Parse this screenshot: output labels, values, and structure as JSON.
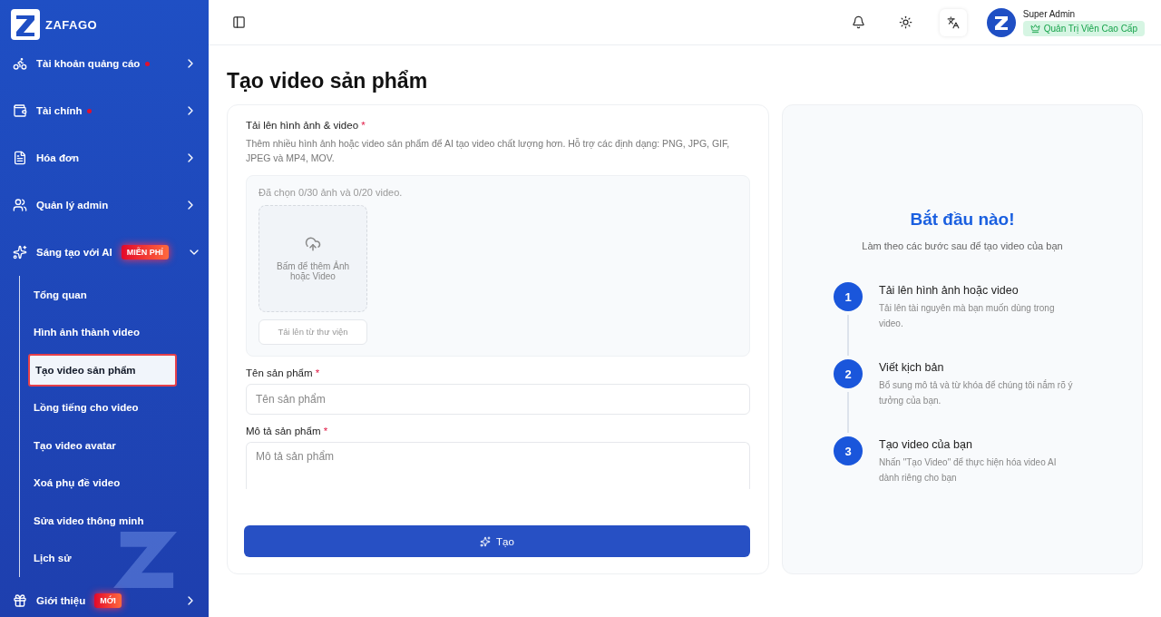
{
  "brand": {
    "name": "ZAFAGO"
  },
  "sidebar": {
    "items": [
      {
        "label": "Tài khoản quảng cáo",
        "dot": true,
        "expanded": false
      },
      {
        "label": "Tài chính",
        "dot": true,
        "expanded": false
      },
      {
        "label": "Hóa đơn",
        "dot": false,
        "expanded": false
      },
      {
        "label": "Quản lý admin",
        "dot": false,
        "expanded": false
      },
      {
        "label": "Sáng tạo với AI",
        "dot": false,
        "badge": "MIỄN PHÍ",
        "expanded": true,
        "children": [
          {
            "label": "Tổng quan",
            "selected": false
          },
          {
            "label": "Hình ảnh thành video",
            "selected": false
          },
          {
            "label": "Tạo video sản phẩm",
            "selected": true
          },
          {
            "label": "Lồng tiếng cho video",
            "selected": false
          },
          {
            "label": "Tạo video avatar",
            "selected": false
          },
          {
            "label": "Xoá phụ đề video",
            "selected": false
          },
          {
            "label": "Sửa video thông minh",
            "selected": false
          },
          {
            "label": "Lịch sử",
            "selected": false
          }
        ]
      },
      {
        "label": "Giới thiệu",
        "dot": false,
        "badge": "MỚI",
        "expanded": false
      }
    ]
  },
  "header": {
    "user": {
      "name": "Super Admin",
      "role": "Quản Trị Viên Cao Cấp"
    }
  },
  "page": {
    "title": "Tạo video sản phẩm"
  },
  "form": {
    "upload": {
      "label": "Tải lên hình ảnh & video",
      "required_mark": "*",
      "description": "Thêm nhiều hình ảnh hoặc video sản phẩm để AI tạo video chất lượng hơn. Hỗ trợ các định dạng: PNG, JPG, GIF, JPEG và MP4, MOV.",
      "count": "Đã chọn 0/30 ảnh và 0/20 video.",
      "dropzone": "Bấm để thêm Ảnh hoặc Video",
      "library_button": "Tải lên từ thư viện"
    },
    "fields": [
      {
        "kind": "input",
        "label": "Tên sản phẩm",
        "required_mark": "*",
        "placeholder": "Tên sản phẩm"
      },
      {
        "kind": "textarea",
        "label": "Mô tả sản phẩm",
        "required_mark": "*",
        "placeholder": "Mô tả sản phẩm"
      }
    ],
    "submit": "Tạo"
  },
  "guide": {
    "title": "Bắt đầu nào!",
    "subtitle": "Làm theo các bước sau để tạo video của bạn",
    "steps": [
      {
        "number": "1",
        "title": "Tải lên hình ảnh hoặc video",
        "text": "Tải lên tài nguyên mà bạn muốn dùng trong video."
      },
      {
        "number": "2",
        "title": "Viết kịch bản",
        "text": "Bổ sung mô tả và từ khóa để chúng tôi nắm rõ ý tưởng của bạn."
      },
      {
        "number": "3",
        "title": "Tạo video của bạn",
        "text": "Nhấn \"Tạo Video\" để thực hiện hóa video AI dành riêng cho bạn"
      }
    ]
  }
}
